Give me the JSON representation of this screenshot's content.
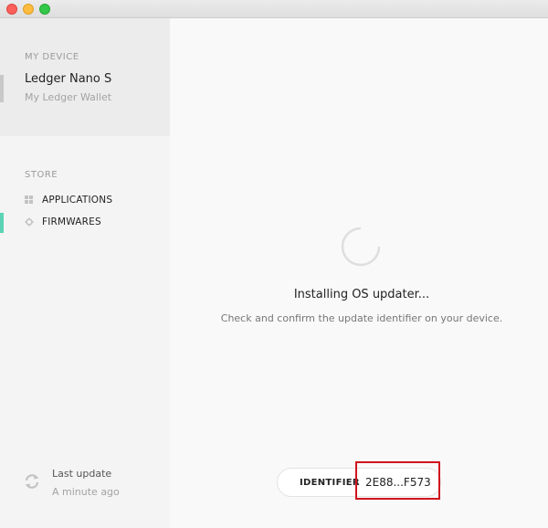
{
  "sidebar": {
    "device_section": {
      "label": "MY DEVICE",
      "device_name": "Ledger Nano S",
      "device_subtitle": "My Ledger Wallet"
    },
    "store_section": {
      "label": "STORE",
      "items": [
        {
          "label": "APPLICATIONS",
          "icon": "grid-icon",
          "active": false
        },
        {
          "label": "FIRMWARES",
          "icon": "gear-icon",
          "active": true
        }
      ]
    },
    "last_update": {
      "title": "Last update",
      "time": "A minute ago",
      "icon": "refresh-icon"
    }
  },
  "main": {
    "status_title": "Installing OS updater...",
    "status_subtitle": "Check and confirm the update identifier on your device.",
    "identifier": {
      "label": "IDENTIFIER",
      "value": "2E88...F573"
    }
  },
  "colors": {
    "accent": "#5bd3b4",
    "highlight": "#d0141e"
  }
}
